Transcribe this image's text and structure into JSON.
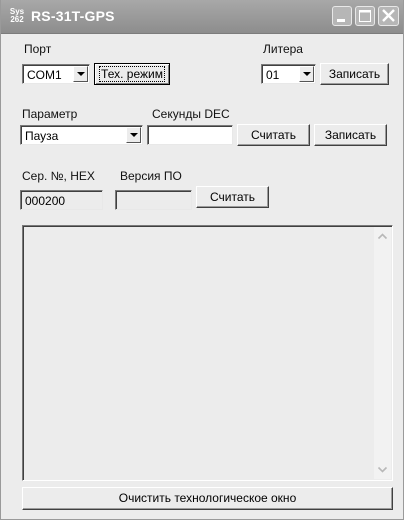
{
  "window": {
    "title": "RS-31T-GPS",
    "icon_text_top": "Sys",
    "icon_text_bottom": "262"
  },
  "port": {
    "label": "Порт",
    "selected": "COM1",
    "tech_mode_button": "Тех. режим"
  },
  "litera": {
    "label": "Литера",
    "selected": "01",
    "write_button": "Записать"
  },
  "parameter": {
    "label": "Параметр",
    "selected": "Пауза",
    "seconds_label": "Секунды DEC",
    "seconds_value": "",
    "read_button": "Считать",
    "write_button": "Записать"
  },
  "serial": {
    "label": "Сер. №, HEX",
    "value": "000200",
    "version_label": "Версия ПО",
    "version_value": "",
    "read_button": "Считать"
  },
  "log": {
    "content": ""
  },
  "footer": {
    "clear_button": "Очистить технологическое окно"
  },
  "icons": [
    "app-icon",
    "minimize-icon",
    "maximize-icon",
    "close-icon",
    "chevron-down-icon",
    "scroll-up-icon",
    "scroll-down-icon"
  ]
}
